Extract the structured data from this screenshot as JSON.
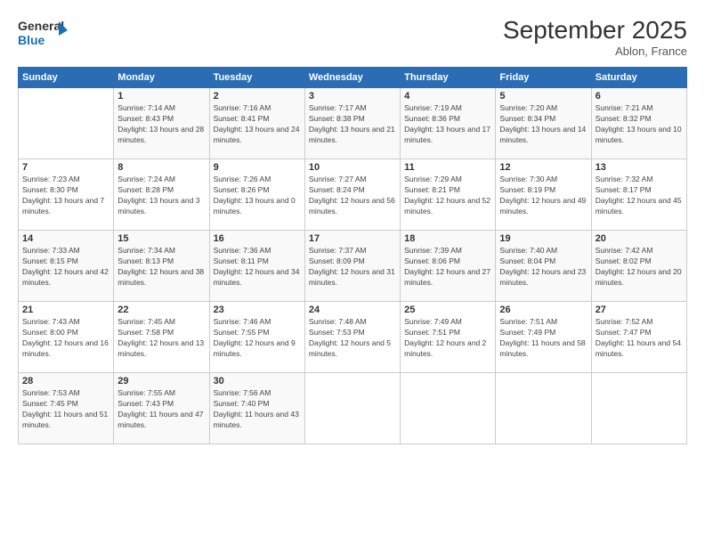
{
  "header": {
    "logo_line1": "General",
    "logo_line2": "Blue",
    "month": "September 2025",
    "location": "Ablon, France"
  },
  "days_of_week": [
    "Sunday",
    "Monday",
    "Tuesday",
    "Wednesday",
    "Thursday",
    "Friday",
    "Saturday"
  ],
  "weeks": [
    [
      {
        "day": "",
        "info": ""
      },
      {
        "day": "1",
        "info": "Sunrise: 7:14 AM\nSunset: 8:43 PM\nDaylight: 13 hours and 28 minutes."
      },
      {
        "day": "2",
        "info": "Sunrise: 7:16 AM\nSunset: 8:41 PM\nDaylight: 13 hours and 24 minutes."
      },
      {
        "day": "3",
        "info": "Sunrise: 7:17 AM\nSunset: 8:38 PM\nDaylight: 13 hours and 21 minutes."
      },
      {
        "day": "4",
        "info": "Sunrise: 7:19 AM\nSunset: 8:36 PM\nDaylight: 13 hours and 17 minutes."
      },
      {
        "day": "5",
        "info": "Sunrise: 7:20 AM\nSunset: 8:34 PM\nDaylight: 13 hours and 14 minutes."
      },
      {
        "day": "6",
        "info": "Sunrise: 7:21 AM\nSunset: 8:32 PM\nDaylight: 13 hours and 10 minutes."
      }
    ],
    [
      {
        "day": "7",
        "info": "Sunrise: 7:23 AM\nSunset: 8:30 PM\nDaylight: 13 hours and 7 minutes."
      },
      {
        "day": "8",
        "info": "Sunrise: 7:24 AM\nSunset: 8:28 PM\nDaylight: 13 hours and 3 minutes."
      },
      {
        "day": "9",
        "info": "Sunrise: 7:26 AM\nSunset: 8:26 PM\nDaylight: 13 hours and 0 minutes."
      },
      {
        "day": "10",
        "info": "Sunrise: 7:27 AM\nSunset: 8:24 PM\nDaylight: 12 hours and 56 minutes."
      },
      {
        "day": "11",
        "info": "Sunrise: 7:29 AM\nSunset: 8:21 PM\nDaylight: 12 hours and 52 minutes."
      },
      {
        "day": "12",
        "info": "Sunrise: 7:30 AM\nSunset: 8:19 PM\nDaylight: 12 hours and 49 minutes."
      },
      {
        "day": "13",
        "info": "Sunrise: 7:32 AM\nSunset: 8:17 PM\nDaylight: 12 hours and 45 minutes."
      }
    ],
    [
      {
        "day": "14",
        "info": "Sunrise: 7:33 AM\nSunset: 8:15 PM\nDaylight: 12 hours and 42 minutes."
      },
      {
        "day": "15",
        "info": "Sunrise: 7:34 AM\nSunset: 8:13 PM\nDaylight: 12 hours and 38 minutes."
      },
      {
        "day": "16",
        "info": "Sunrise: 7:36 AM\nSunset: 8:11 PM\nDaylight: 12 hours and 34 minutes."
      },
      {
        "day": "17",
        "info": "Sunrise: 7:37 AM\nSunset: 8:09 PM\nDaylight: 12 hours and 31 minutes."
      },
      {
        "day": "18",
        "info": "Sunrise: 7:39 AM\nSunset: 8:06 PM\nDaylight: 12 hours and 27 minutes."
      },
      {
        "day": "19",
        "info": "Sunrise: 7:40 AM\nSunset: 8:04 PM\nDaylight: 12 hours and 23 minutes."
      },
      {
        "day": "20",
        "info": "Sunrise: 7:42 AM\nSunset: 8:02 PM\nDaylight: 12 hours and 20 minutes."
      }
    ],
    [
      {
        "day": "21",
        "info": "Sunrise: 7:43 AM\nSunset: 8:00 PM\nDaylight: 12 hours and 16 minutes."
      },
      {
        "day": "22",
        "info": "Sunrise: 7:45 AM\nSunset: 7:58 PM\nDaylight: 12 hours and 13 minutes."
      },
      {
        "day": "23",
        "info": "Sunrise: 7:46 AM\nSunset: 7:55 PM\nDaylight: 12 hours and 9 minutes."
      },
      {
        "day": "24",
        "info": "Sunrise: 7:48 AM\nSunset: 7:53 PM\nDaylight: 12 hours and 5 minutes."
      },
      {
        "day": "25",
        "info": "Sunrise: 7:49 AM\nSunset: 7:51 PM\nDaylight: 12 hours and 2 minutes."
      },
      {
        "day": "26",
        "info": "Sunrise: 7:51 AM\nSunset: 7:49 PM\nDaylight: 11 hours and 58 minutes."
      },
      {
        "day": "27",
        "info": "Sunrise: 7:52 AM\nSunset: 7:47 PM\nDaylight: 11 hours and 54 minutes."
      }
    ],
    [
      {
        "day": "28",
        "info": "Sunrise: 7:53 AM\nSunset: 7:45 PM\nDaylight: 11 hours and 51 minutes."
      },
      {
        "day": "29",
        "info": "Sunrise: 7:55 AM\nSunset: 7:43 PM\nDaylight: 11 hours and 47 minutes."
      },
      {
        "day": "30",
        "info": "Sunrise: 7:56 AM\nSunset: 7:40 PM\nDaylight: 11 hours and 43 minutes."
      },
      {
        "day": "",
        "info": ""
      },
      {
        "day": "",
        "info": ""
      },
      {
        "day": "",
        "info": ""
      },
      {
        "day": "",
        "info": ""
      }
    ]
  ]
}
